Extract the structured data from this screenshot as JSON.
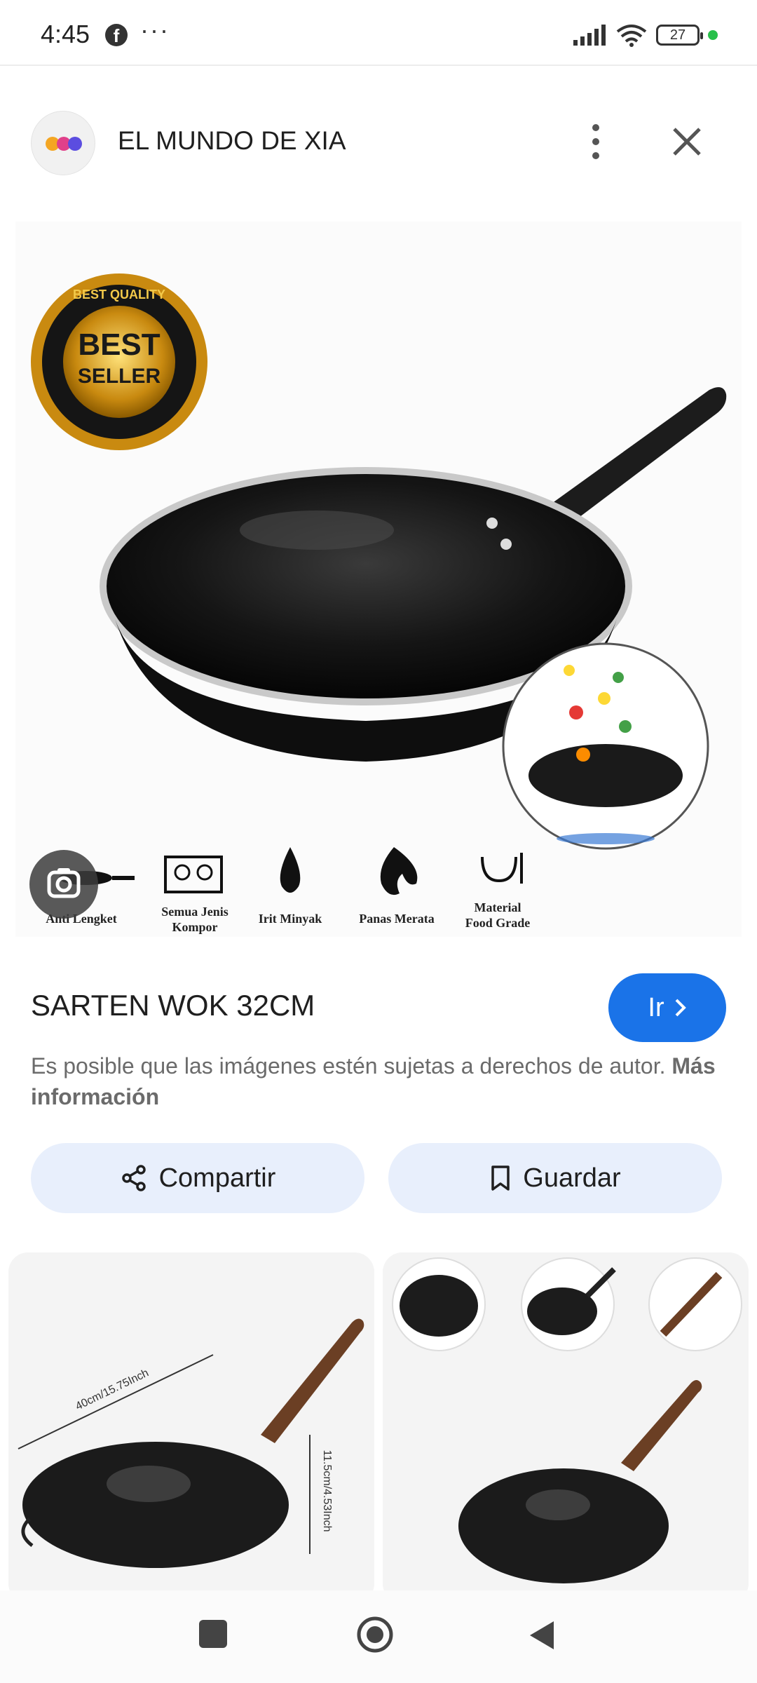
{
  "status_bar": {
    "time": "4:45",
    "more": "···",
    "battery": "27",
    "icons": [
      "facebook-icon",
      "signal-icon",
      "wifi-icon",
      "battery-icon"
    ]
  },
  "header": {
    "site_title": "EL MUNDO DE XIA",
    "icons": [
      "site-logo",
      "more-vert-icon",
      "close-icon"
    ]
  },
  "hero": {
    "badge_line1": "BEST",
    "badge_line2": "SELLER",
    "badge_ring": "BEST QUALITY",
    "features": [
      {
        "label": "Anti Lengket"
      },
      {
        "label1": "Semua Jenis",
        "label2": "Kompor"
      },
      {
        "label": "Irit Minyak"
      },
      {
        "label": "Panas Merata"
      },
      {
        "label1": "Material",
        "label2": "Food Grade"
      }
    ]
  },
  "product": {
    "title": "SARTEN WOK 32CM",
    "go_label": "Ir",
    "notice_text": "Es posible que las imágenes estén sujetas a derechos de autor.",
    "notice_link": "Más información"
  },
  "actions": {
    "share_label": "Compartir",
    "save_label": "Guardar"
  },
  "related": {
    "thumb1_dim1": "40cm/15.75Inch",
    "thumb1_dim2": "11.5cm/4.53Inch"
  },
  "colors": {
    "accent": "#1a73e8",
    "pill_bg": "#e8effc"
  }
}
